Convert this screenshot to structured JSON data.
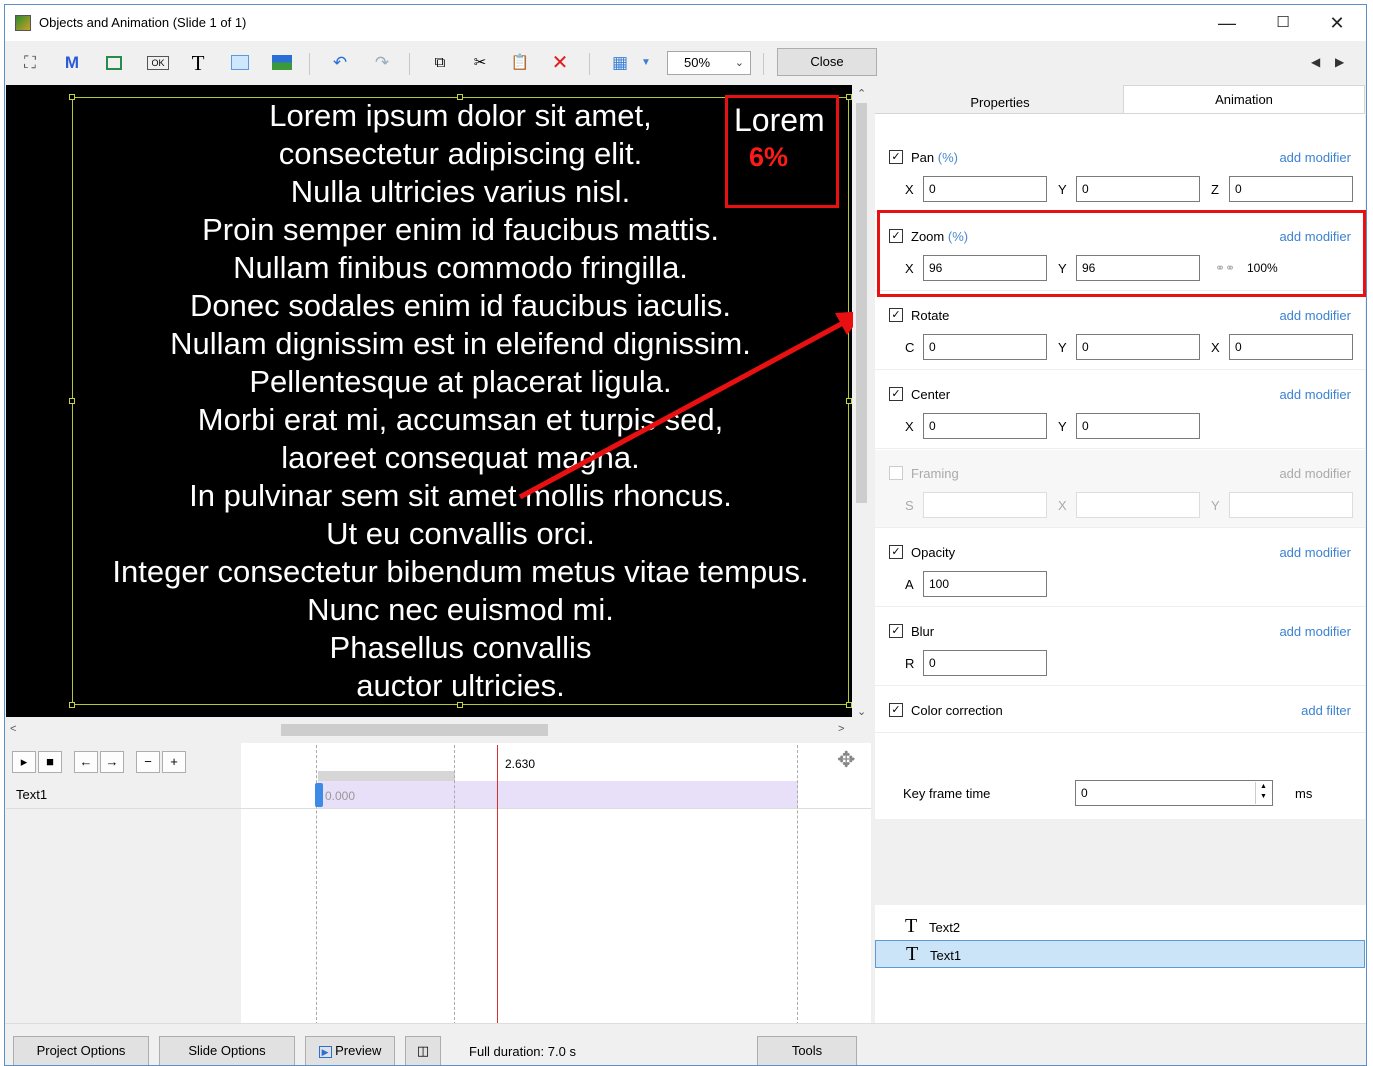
{
  "window": {
    "title": "Objects and Animation (Slide 1 of 1)",
    "minimize": "—",
    "maximize": "☐",
    "close": "✕"
  },
  "toolbar": {
    "zoom_value": "50%",
    "close_label": "Close",
    "icons": [
      "camera-icon",
      "m-icon",
      "rectangle-icon",
      "button-icon",
      "text-icon",
      "frame-icon",
      "image-icon",
      "undo-icon",
      "redo-icon",
      "copy-icon",
      "cut-icon",
      "paste-icon",
      "delete-icon",
      "grid-icon"
    ]
  },
  "canvas": {
    "lines": [
      "Lorem ipsum dolor sit amet,",
      "consectetur adipiscing elit.",
      "Nulla ultricies varius nisl.",
      "Proin semper enim id faucibus mattis.",
      "Nullam finibus commodo fringilla.",
      "Donec sodales enim id faucibus iaculis.",
      "Nullam dignissim est in eleifend dignissim.",
      "Pellentesque at placerat ligula.",
      "Morbi erat mi, accumsan et turpis sed,",
      "laoreet consequat magna.",
      "In pulvinar sem sit amet mollis rhoncus.",
      "Ut eu convallis orci.",
      "Integer consectetur bibendum metus vitae tempus.",
      "Nunc nec euismod mi.",
      "Phasellus convallis",
      "auctor ultricies."
    ],
    "preview_word": "Lorem",
    "preview_percent": "6%",
    "accent_color": "#e81010"
  },
  "timeline": {
    "playhead_time": "2.630",
    "track_name": "Text1",
    "keyframe_time": "0.000"
  },
  "panel": {
    "tabs": {
      "properties": "Properties",
      "animation": "Animation"
    },
    "add_modifier": "add modifier",
    "add_filter": "add filter",
    "unit_pct": "(%)",
    "pan": {
      "title": "Pan",
      "x": "0",
      "y": "0",
      "z": "0"
    },
    "zoom": {
      "title": "Zoom",
      "x": "96",
      "y": "96",
      "link_value": "100%"
    },
    "rotate": {
      "title": "Rotate",
      "c": "0",
      "y": "0",
      "x": "0"
    },
    "center": {
      "title": "Center",
      "x": "0",
      "y": "0"
    },
    "framing": {
      "title": "Framing"
    },
    "opacity": {
      "title": "Opacity",
      "a": "100"
    },
    "blur": {
      "title": "Blur",
      "r": "0"
    },
    "color_correction": {
      "title": "Color correction"
    },
    "key_frame_time": {
      "label": "Key frame time",
      "value": "0",
      "unit": "ms"
    },
    "objects": [
      "Text2",
      "Text1"
    ],
    "selected_object": "Text1"
  },
  "bottom": {
    "project_options": "Project Options",
    "slide_options": "Slide Options",
    "preview": "Preview",
    "full_duration": "Full duration: 7.0 s",
    "tools": "Tools"
  }
}
